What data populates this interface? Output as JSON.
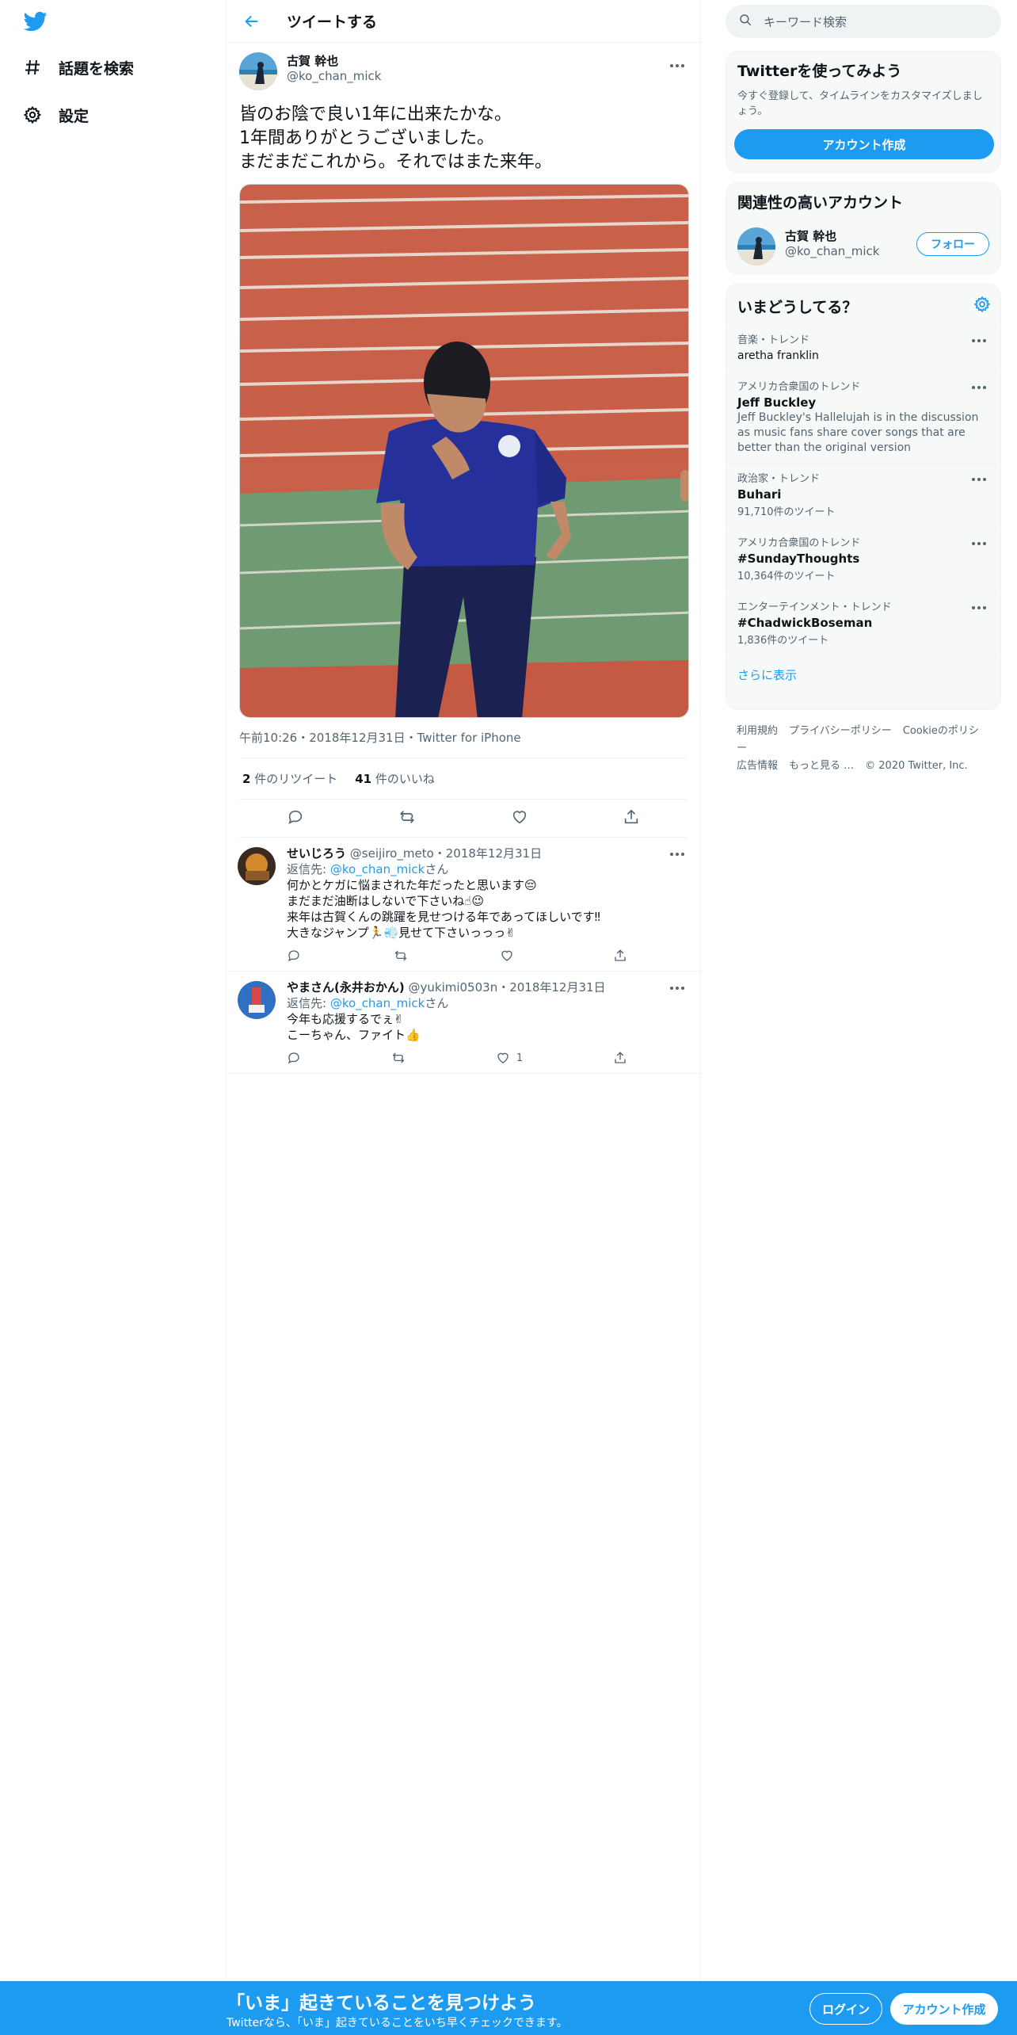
{
  "nav": {
    "explore_label": "話題を検索",
    "settings_label": "設定"
  },
  "header": {
    "title": "ツイートする"
  },
  "tweet": {
    "author_name": "古賀 幹也",
    "author_handle": "@ko_chan_mick",
    "lines": [
      "皆のお陰で良い1年に出来たかな。",
      "1年間ありがとうございました。",
      "まだまだこれから。それではまた来年。"
    ],
    "meta": "午前10:26・2018年12月31日・Twitter for iPhone",
    "retweet_count": "2",
    "retweet_label": "件のリツイート",
    "like_count": "41",
    "like_label": "件のいいね"
  },
  "replies": [
    {
      "name": "せいじろう",
      "handle_date": "@seijiro_meto・2018年12月31日",
      "reply_prefix": "返信先: ",
      "reply_to": "@ko_chan_mick",
      "reply_suffix": "さん",
      "lines": [
        "何かとケガに悩まされた年だったと思います😔",
        "まだまだ油断はしないで下さいね☝😉",
        "来年は古賀くんの跳躍を見せつける年であってほしいです‼",
        "大きなジャンプ🏃💨見せて下さいっっっ✌"
      ],
      "like_count": ""
    },
    {
      "name": "やまさん(永井おかん)",
      "handle_date": "@yukimi0503n・2018年12月31日",
      "reply_prefix": "返信先: ",
      "reply_to": "@ko_chan_mick",
      "reply_suffix": "さん",
      "lines": [
        "今年も応援するでぇ✌",
        "こーちゃん、ファイト👍"
      ],
      "like_count": "1"
    }
  ],
  "search": {
    "placeholder": "キーワード検索"
  },
  "signup": {
    "title": "Twitterを使ってみよう",
    "desc": "今すぐ登録して、タイムラインをカスタマイズしましょう。",
    "button": "アカウント作成"
  },
  "related": {
    "title": "関連性の高いアカウント",
    "name": "古賀 幹也",
    "handle": "@ko_chan_mick",
    "follow": "フォロー"
  },
  "trends": {
    "title": "いまどうしてる？",
    "items": [
      {
        "category": "音楽・トレンド",
        "name": "aretha franklin",
        "desc": "",
        "count": ""
      },
      {
        "category": "アメリカ合衆国のトレンド",
        "name": "Jeff Buckley",
        "desc": "Jeff Buckley's Hallelujah is in the discussion as music fans share cover songs that are better than the original version",
        "count": ""
      },
      {
        "category": "政治家・トレンド",
        "name": "Buhari",
        "desc": "",
        "count": "91,710件のツイート"
      },
      {
        "category": "アメリカ合衆国のトレンド",
        "name": "#SundayThoughts",
        "desc": "",
        "count": "10,364件のツイート"
      },
      {
        "category": "エンターテインメント・トレンド",
        "name": "#ChadwickBoseman",
        "desc": "",
        "count": "1,836件のツイート"
      }
    ],
    "show_more": "さらに表示"
  },
  "footer": {
    "links": [
      "利用規約",
      "プライバシーポリシー",
      "Cookieのポリシー",
      "広告情報",
      "もっと見る …"
    ],
    "copyright": "© 2020 Twitter, Inc."
  },
  "bottom_bar": {
    "title": "「いま」起きていることを見つけよう",
    "subtitle": "Twitterなら、「いま」起きていることをいち早くチェックできます。",
    "login": "ログイン",
    "signup": "アカウント作成"
  },
  "colors": {
    "accent": "#1d9bf0",
    "text": "#0f1419",
    "muted": "#536471"
  }
}
